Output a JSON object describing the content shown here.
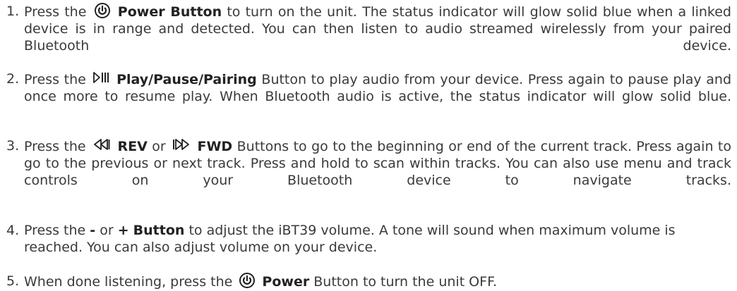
{
  "steps": [
    {
      "num": "1.",
      "pre": "Press the",
      "icon": "power-icon",
      "bold1": "Power Button",
      "post": "to turn on the unit. The status indicator will glow solid blue when a linked device is in range and detected. You can then listen to audio streamed wirelessly from your paired  Bluetooth device."
    },
    {
      "num": "2.",
      "pre": "Press the",
      "icon": "play-pause-pairing-icon",
      "bold1": "Play/Pause/Pairing",
      "post": "Button to play audio from your device. Press again to pause play and once more to resume play. When Bluetooth audio is active, the status indicator will glow solid blue."
    },
    {
      "num": "3.",
      "pre": "Press the",
      "icon1": "rewind-icon",
      "bold1": "REV",
      "mid": "or",
      "icon2": "forward-icon",
      "bold2": "FWD",
      "post1": "Button",
      "post2": "s to go to the beginning or end of the current track. Press again to go to the previous or next track. Press and hold to scan within tracks. You can also use menu and track controls on your Bluetooth device to navigate tracks."
    },
    {
      "num": "4.",
      "pre": "Press the",
      "bold_minus": "-",
      "mid": "or",
      "bold_plus": "+",
      "bold1": "Button",
      "post": "to adjust the iBT39 volume. A tone will sound when maximum volume is reached. You can also adjust volume on your device."
    },
    {
      "num": "5.",
      "pre": "When done listening, press the",
      "icon": "power-icon",
      "bold1": "Power",
      "post": "Button to turn the unit OFF."
    }
  ]
}
